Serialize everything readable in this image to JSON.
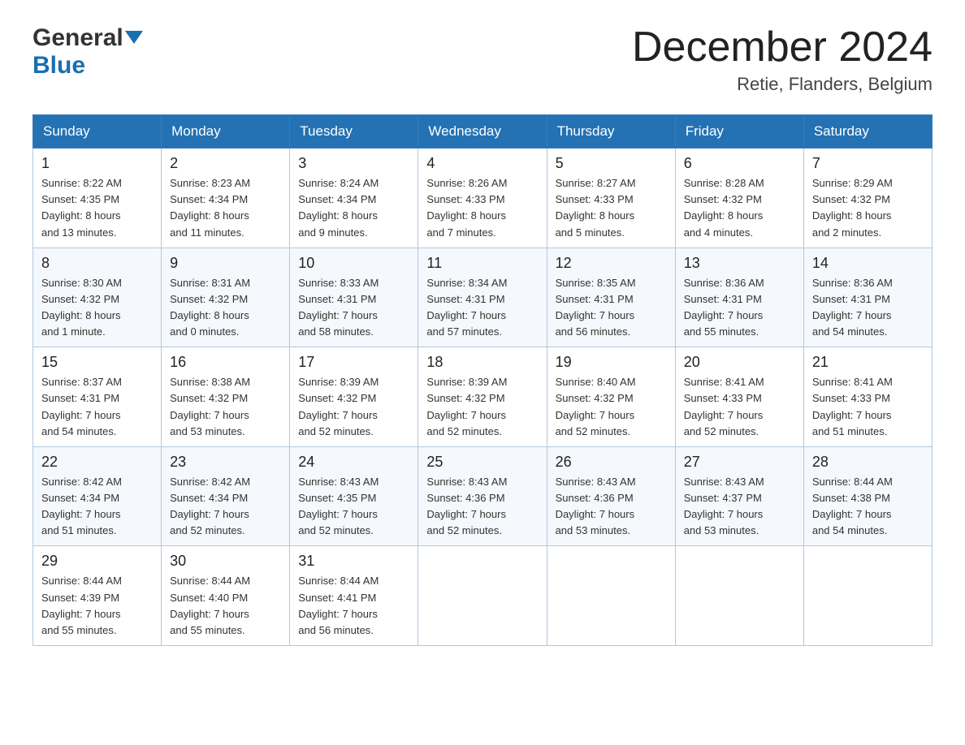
{
  "logo": {
    "general": "General",
    "blue": "Blue"
  },
  "title": {
    "month_year": "December 2024",
    "location": "Retie, Flanders, Belgium"
  },
  "headers": [
    "Sunday",
    "Monday",
    "Tuesday",
    "Wednesday",
    "Thursday",
    "Friday",
    "Saturday"
  ],
  "weeks": [
    [
      {
        "day": "1",
        "info": "Sunrise: 8:22 AM\nSunset: 4:35 PM\nDaylight: 8 hours\nand 13 minutes."
      },
      {
        "day": "2",
        "info": "Sunrise: 8:23 AM\nSunset: 4:34 PM\nDaylight: 8 hours\nand 11 minutes."
      },
      {
        "day": "3",
        "info": "Sunrise: 8:24 AM\nSunset: 4:34 PM\nDaylight: 8 hours\nand 9 minutes."
      },
      {
        "day": "4",
        "info": "Sunrise: 8:26 AM\nSunset: 4:33 PM\nDaylight: 8 hours\nand 7 minutes."
      },
      {
        "day": "5",
        "info": "Sunrise: 8:27 AM\nSunset: 4:33 PM\nDaylight: 8 hours\nand 5 minutes."
      },
      {
        "day": "6",
        "info": "Sunrise: 8:28 AM\nSunset: 4:32 PM\nDaylight: 8 hours\nand 4 minutes."
      },
      {
        "day": "7",
        "info": "Sunrise: 8:29 AM\nSunset: 4:32 PM\nDaylight: 8 hours\nand 2 minutes."
      }
    ],
    [
      {
        "day": "8",
        "info": "Sunrise: 8:30 AM\nSunset: 4:32 PM\nDaylight: 8 hours\nand 1 minute."
      },
      {
        "day": "9",
        "info": "Sunrise: 8:31 AM\nSunset: 4:32 PM\nDaylight: 8 hours\nand 0 minutes."
      },
      {
        "day": "10",
        "info": "Sunrise: 8:33 AM\nSunset: 4:31 PM\nDaylight: 7 hours\nand 58 minutes."
      },
      {
        "day": "11",
        "info": "Sunrise: 8:34 AM\nSunset: 4:31 PM\nDaylight: 7 hours\nand 57 minutes."
      },
      {
        "day": "12",
        "info": "Sunrise: 8:35 AM\nSunset: 4:31 PM\nDaylight: 7 hours\nand 56 minutes."
      },
      {
        "day": "13",
        "info": "Sunrise: 8:36 AM\nSunset: 4:31 PM\nDaylight: 7 hours\nand 55 minutes."
      },
      {
        "day": "14",
        "info": "Sunrise: 8:36 AM\nSunset: 4:31 PM\nDaylight: 7 hours\nand 54 minutes."
      }
    ],
    [
      {
        "day": "15",
        "info": "Sunrise: 8:37 AM\nSunset: 4:31 PM\nDaylight: 7 hours\nand 54 minutes."
      },
      {
        "day": "16",
        "info": "Sunrise: 8:38 AM\nSunset: 4:32 PM\nDaylight: 7 hours\nand 53 minutes."
      },
      {
        "day": "17",
        "info": "Sunrise: 8:39 AM\nSunset: 4:32 PM\nDaylight: 7 hours\nand 52 minutes."
      },
      {
        "day": "18",
        "info": "Sunrise: 8:39 AM\nSunset: 4:32 PM\nDaylight: 7 hours\nand 52 minutes."
      },
      {
        "day": "19",
        "info": "Sunrise: 8:40 AM\nSunset: 4:32 PM\nDaylight: 7 hours\nand 52 minutes."
      },
      {
        "day": "20",
        "info": "Sunrise: 8:41 AM\nSunset: 4:33 PM\nDaylight: 7 hours\nand 52 minutes."
      },
      {
        "day": "21",
        "info": "Sunrise: 8:41 AM\nSunset: 4:33 PM\nDaylight: 7 hours\nand 51 minutes."
      }
    ],
    [
      {
        "day": "22",
        "info": "Sunrise: 8:42 AM\nSunset: 4:34 PM\nDaylight: 7 hours\nand 51 minutes."
      },
      {
        "day": "23",
        "info": "Sunrise: 8:42 AM\nSunset: 4:34 PM\nDaylight: 7 hours\nand 52 minutes."
      },
      {
        "day": "24",
        "info": "Sunrise: 8:43 AM\nSunset: 4:35 PM\nDaylight: 7 hours\nand 52 minutes."
      },
      {
        "day": "25",
        "info": "Sunrise: 8:43 AM\nSunset: 4:36 PM\nDaylight: 7 hours\nand 52 minutes."
      },
      {
        "day": "26",
        "info": "Sunrise: 8:43 AM\nSunset: 4:36 PM\nDaylight: 7 hours\nand 53 minutes."
      },
      {
        "day": "27",
        "info": "Sunrise: 8:43 AM\nSunset: 4:37 PM\nDaylight: 7 hours\nand 53 minutes."
      },
      {
        "day": "28",
        "info": "Sunrise: 8:44 AM\nSunset: 4:38 PM\nDaylight: 7 hours\nand 54 minutes."
      }
    ],
    [
      {
        "day": "29",
        "info": "Sunrise: 8:44 AM\nSunset: 4:39 PM\nDaylight: 7 hours\nand 55 minutes."
      },
      {
        "day": "30",
        "info": "Sunrise: 8:44 AM\nSunset: 4:40 PM\nDaylight: 7 hours\nand 55 minutes."
      },
      {
        "day": "31",
        "info": "Sunrise: 8:44 AM\nSunset: 4:41 PM\nDaylight: 7 hours\nand 56 minutes."
      },
      null,
      null,
      null,
      null
    ]
  ]
}
